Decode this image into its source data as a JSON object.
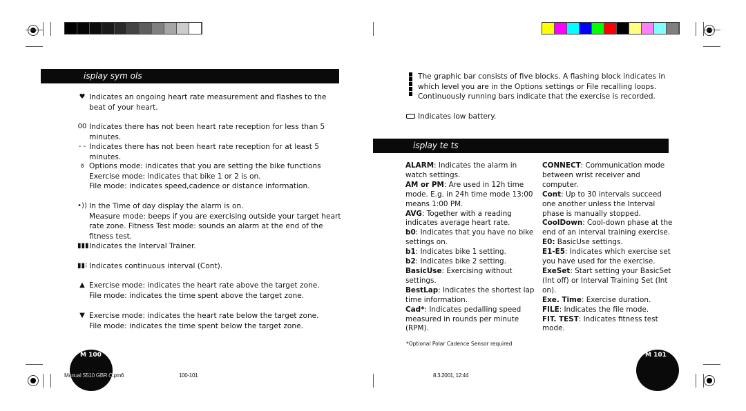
{
  "gray_ramp": [
    "#000000",
    "#050505",
    "#0d0d0d",
    "#1a1a1a",
    "#2a2a2a",
    "#444444",
    "#5e5e5e",
    "#808080",
    "#a6a6a6",
    "#cccccc",
    "#ffffff"
  ],
  "color_bar": [
    "#ffff00",
    "#ff00ff",
    "#00ffff",
    "#0000ff",
    "#00ff00",
    "#ff0000",
    "#000000",
    "#ffff80",
    "#ff80ff",
    "#80ffff",
    "#808080"
  ],
  "left": {
    "heading": "isplay sym  ols",
    "entries": [
      {
        "icon": "heart-icon",
        "glyph": "♥",
        "text": "Indicates an ongoing heart rate measurement and flashes to the beat of your heart."
      },
      {
        "icon": "no-reception-digits-icon",
        "glyph": "00",
        "text": "Indicates there has not been heart rate reception for less than 5 minutes."
      },
      {
        "icon": "dashes-icon",
        "glyph": "- -",
        "text": "Indicates there has not been heart rate reception for at least 5 minutes."
      },
      {
        "icon": "bike-icon",
        "glyph": "ᴕ",
        "text": "Options mode: indicates that you are setting the bike functions\nExercise mode: indicates that bike 1 or 2 is on.\nFile mode: indicates speed,cadence or distance information."
      },
      {
        "icon": "alarm-icon",
        "glyph": "•))",
        "text": "In the Time of day display the alarm is on.\nMeasure mode: beeps if you are exercising outside your target heart rate zone. Fitness Test mode: sounds an alarm at the end of the fitness test."
      },
      {
        "icon": "interval-trainer-icon",
        "glyph": "▮▮▮",
        "text": "Indicates the Interval Trainer."
      },
      {
        "icon": "continuous-interval-icon",
        "glyph": "▮▮⁝",
        "text": "Indicates continuous interval (Cont)."
      },
      {
        "icon": "arrow-up-icon",
        "glyph": "▲",
        "text": "Exercise mode: indicates the heart rate above the target zone.\nFile mode: indicates the time spent above the target zone."
      },
      {
        "icon": "arrow-down-icon",
        "glyph": "▼",
        "text": "Exercise mode: indicates the heart rate below the target zone.\nFile mode: indicates the time spent below the target zone."
      }
    ],
    "page_number": "M 100"
  },
  "right": {
    "graphic_bar_text": "The graphic bar consists of five blocks. A flashing block indicates in which level you are in the Options settings or File recalling loops. Continuously running bars indicate that the exercise is recorded.",
    "battery_text": "Indicates low battery.",
    "heading": "isplay te  ts",
    "col1": [
      {
        "term": "ALARM",
        "def": ": Indicates the alarm in watch settings."
      },
      {
        "term": "AM or PM",
        "def": ": Are used in 12h time mode. E.g. in 24h time mode 13:00 means 1:00 PM."
      },
      {
        "term": "AVG",
        "def": ": Together with a reading indicates average heart rate."
      },
      {
        "term": "b0",
        "def": ": Indicates that you have no bike settings on."
      },
      {
        "term": "b1",
        "def": ": Indicates bike 1 setting."
      },
      {
        "term": "b2",
        "def": ": Indicates bike 2 setting."
      },
      {
        "term": "BasicUse",
        "def": ": Exercising without settings."
      },
      {
        "term": "BestLap",
        "def": ": Indicates the shortest lap time information."
      },
      {
        "term": "Cad*",
        "def": ": Indicates pedalling speed measured in rounds per minute (RPM)."
      }
    ],
    "col2": [
      {
        "term": "CONNECT",
        "def": ": Communication mode between wrist receiver and computer."
      },
      {
        "term": "Cont",
        "def": ": Up to 30 intervals succeed one another unless the Interval phase is manually stopped."
      },
      {
        "term": "CoolDown",
        "def": ": Cool-down phase at the end of an interval training exercise."
      },
      {
        "term": "E0:",
        "def": " BasicUse settings."
      },
      {
        "term": "E1-E5",
        "def": ": Indicates which exercise set you have used for the exercise."
      },
      {
        "term": "ExeSet",
        "def": ": Start setting your BasicSet (Int off) or Interval Training Set (Int on)."
      },
      {
        "term": "Exe. Time",
        "def": ": Exercise duration."
      },
      {
        "term": "FILE",
        "def": ": Indicates the file mode."
      },
      {
        "term": "FIT. TEST",
        "def": ": Indicates fitness test mode."
      }
    ],
    "footnote": "*Optional Polar Cadence Sensor required",
    "page_number": "M 101"
  },
  "footer": {
    "file": "Manual S510 GBR C.pm6",
    "pages": "100-101",
    "date": "8.3.2001, 12:44"
  }
}
